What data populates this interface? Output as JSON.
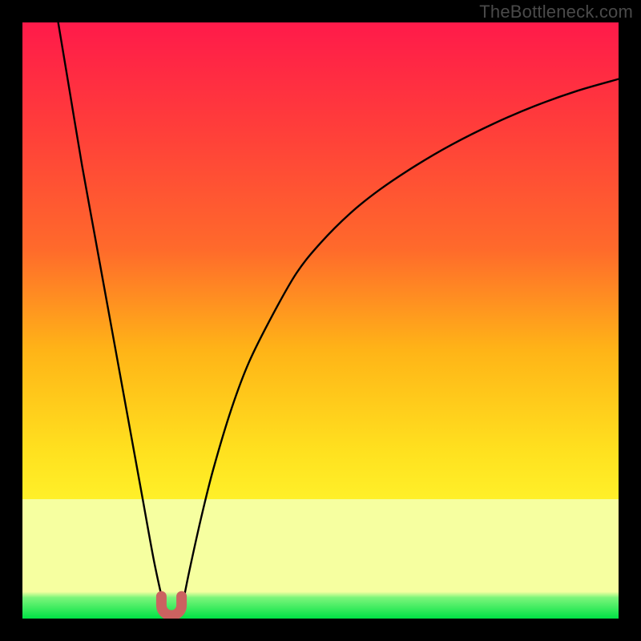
{
  "watermark": "TheBottleneck.com",
  "colors": {
    "gradient_top": "#ff1a4a",
    "gradient_upper_mid": "#ff6a2b",
    "gradient_mid": "#ffb417",
    "gradient_lower_mid": "#fff029",
    "gradient_pale": "#f6ffa0",
    "gradient_bottom": "#00e245",
    "curve": "#000000",
    "marker": "#cb6260",
    "frame": "#000000"
  },
  "chart_data": {
    "type": "line",
    "title": "",
    "xlabel": "",
    "ylabel": "",
    "xlim": [
      0,
      100
    ],
    "ylim": [
      0,
      100
    ],
    "grid": false,
    "annotations": [],
    "series": [
      {
        "name": "left-branch",
        "x": [
          6,
          8,
          10,
          12,
          14,
          16,
          18,
          20,
          22,
          23.5
        ],
        "values": [
          100,
          88,
          76,
          65,
          54,
          43,
          32,
          21,
          10,
          3
        ]
      },
      {
        "name": "right-branch",
        "x": [
          27,
          28,
          30,
          32,
          35,
          38,
          42,
          46,
          50,
          55,
          60,
          66,
          72,
          79,
          86,
          93,
          100
        ],
        "values": [
          3,
          8,
          17,
          25,
          35,
          43,
          51,
          58,
          63,
          68,
          72,
          76,
          79.5,
          83,
          86,
          88.5,
          90.5
        ]
      }
    ],
    "marker": {
      "name": "u-shape-minimum",
      "x_range": [
        23,
        27
      ],
      "y_range": [
        0,
        4
      ],
      "shape": "U"
    },
    "gradient_stops_y_percent_from_top": [
      {
        "offset": 0,
        "note": "red/pink top"
      },
      {
        "offset": 40,
        "note": "orange"
      },
      {
        "offset": 65,
        "note": "yellow"
      },
      {
        "offset": 82,
        "note": "pale yellow band"
      },
      {
        "offset": 97,
        "note": "bright green bottom"
      }
    ]
  }
}
